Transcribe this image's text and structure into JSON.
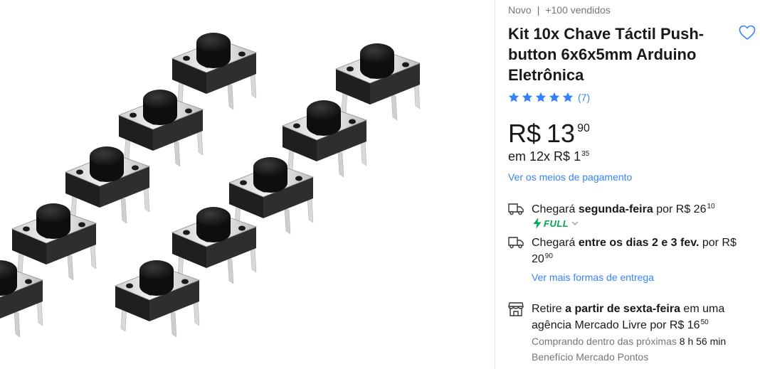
{
  "product": {
    "condition": "Novo",
    "separator": "|",
    "sold": "+100 vendidos",
    "title": "Kit 10x Chave Táctil Push-button 6x6x5mm Arduino Eletrônica",
    "favorite_icon": "heart-icon",
    "rating": {
      "stars": 5,
      "count_label": "(7)",
      "star_color": "#3483fa"
    },
    "price": {
      "currency": "R$",
      "integer": "13",
      "cents": "90"
    },
    "installments": {
      "prefix": "em 12x",
      "currency": "R$",
      "integer": "1",
      "cents": "35"
    },
    "payment_link": "Ver os meios de pagamento"
  },
  "shipping": [
    {
      "icon": "truck-icon",
      "prefix": "Chegará ",
      "bold": "segunda-feira",
      "suffix": " por R$ 26",
      "cents": "10",
      "badge": {
        "icon": "bolt-icon",
        "label": "FULL",
        "color": "#00a650"
      }
    },
    {
      "icon": "truck-icon",
      "prefix": "Chegará ",
      "bold": "entre os dias 2 e 3 fev.",
      "suffix": " por R$ 20",
      "cents": "90",
      "link": "Ver mais formas de entrega"
    },
    {
      "icon": "store-icon",
      "prefix": "Retire ",
      "bold": "a partir de sexta-feira",
      "suffix": " em uma agência Mercado Livre por R$ 16",
      "cents": "50",
      "note_prefix": "Comprando dentro das próximas ",
      "note_time": "8 h 56 min",
      "note_line2": "Benefício Mercado Pontos"
    }
  ],
  "colors": {
    "link": "#3483fa",
    "full": "#00a650",
    "divider": "#e6e6e6"
  }
}
